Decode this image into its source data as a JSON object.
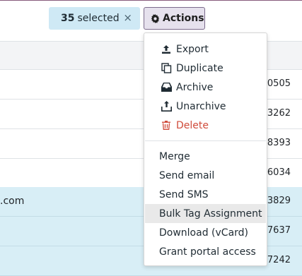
{
  "selection": {
    "count": "35",
    "label": "selected",
    "close_glyph": "×"
  },
  "actions_button": {
    "label": "Actions"
  },
  "rows": [
    {
      "left": "",
      "right": "-0505",
      "selected": false
    },
    {
      "left": "",
      "right": "-3262",
      "selected": false
    },
    {
      "left": "",
      "right": "-8393",
      "selected": false
    },
    {
      "left": "",
      "right": "-6034",
      "selected": false
    },
    {
      "left": ".com",
      "right": "-3829",
      "selected": true
    },
    {
      "left": "",
      "right": "-7637",
      "selected": true
    },
    {
      "left": "",
      "right": "-7242",
      "selected": true
    }
  ],
  "menu": {
    "icon_items": [
      {
        "label": "Export",
        "icon": "upload-icon",
        "danger": false
      },
      {
        "label": "Duplicate",
        "icon": "copy-icon",
        "danger": false
      },
      {
        "label": "Archive",
        "icon": "inbox-icon",
        "danger": false
      },
      {
        "label": "Unarchive",
        "icon": "unarchive-icon",
        "danger": false
      },
      {
        "label": "Delete",
        "icon": "trash-icon",
        "danger": true
      }
    ],
    "text_items": [
      {
        "label": "Merge",
        "hover": false
      },
      {
        "label": "Send email",
        "hover": false
      },
      {
        "label": "Send SMS",
        "hover": false
      },
      {
        "label": "Bulk Tag Assignment",
        "hover": true
      },
      {
        "label": "Download (vCard)",
        "hover": false
      },
      {
        "label": "Grant portal access",
        "hover": false
      }
    ]
  },
  "colors": {
    "accent": "#875a7b",
    "selected_bg": "#cfe9f5",
    "danger": "#d04b3a"
  }
}
